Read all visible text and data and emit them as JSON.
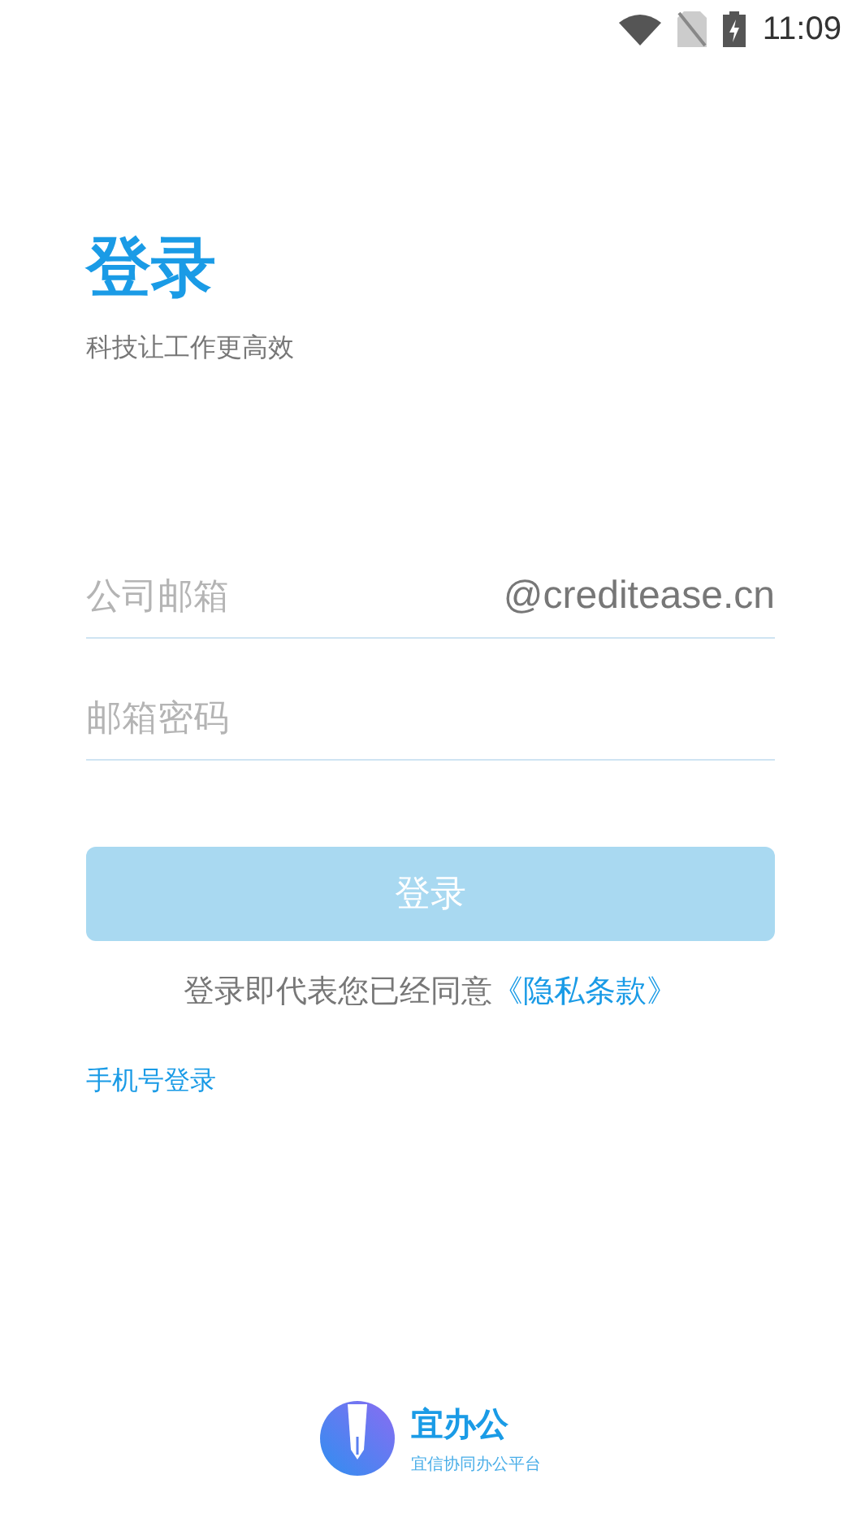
{
  "status_bar": {
    "time": "11:09"
  },
  "header": {
    "title": "登录",
    "subtitle": "科技让工作更高效"
  },
  "fields": [
    {
      "placeholder": "公司邮箱",
      "suffix": "@creditease.cn"
    },
    {
      "placeholder": "邮箱密码"
    }
  ],
  "login_button": {
    "label": "登录",
    "disabled": true
  },
  "agreement": {
    "text": "登录即代表您已经同意",
    "link": "《隐私条款》"
  },
  "phone_login": "手机号登录",
  "brand": {
    "name": "宜办公",
    "tagline": "宜信协同办公平台"
  }
}
